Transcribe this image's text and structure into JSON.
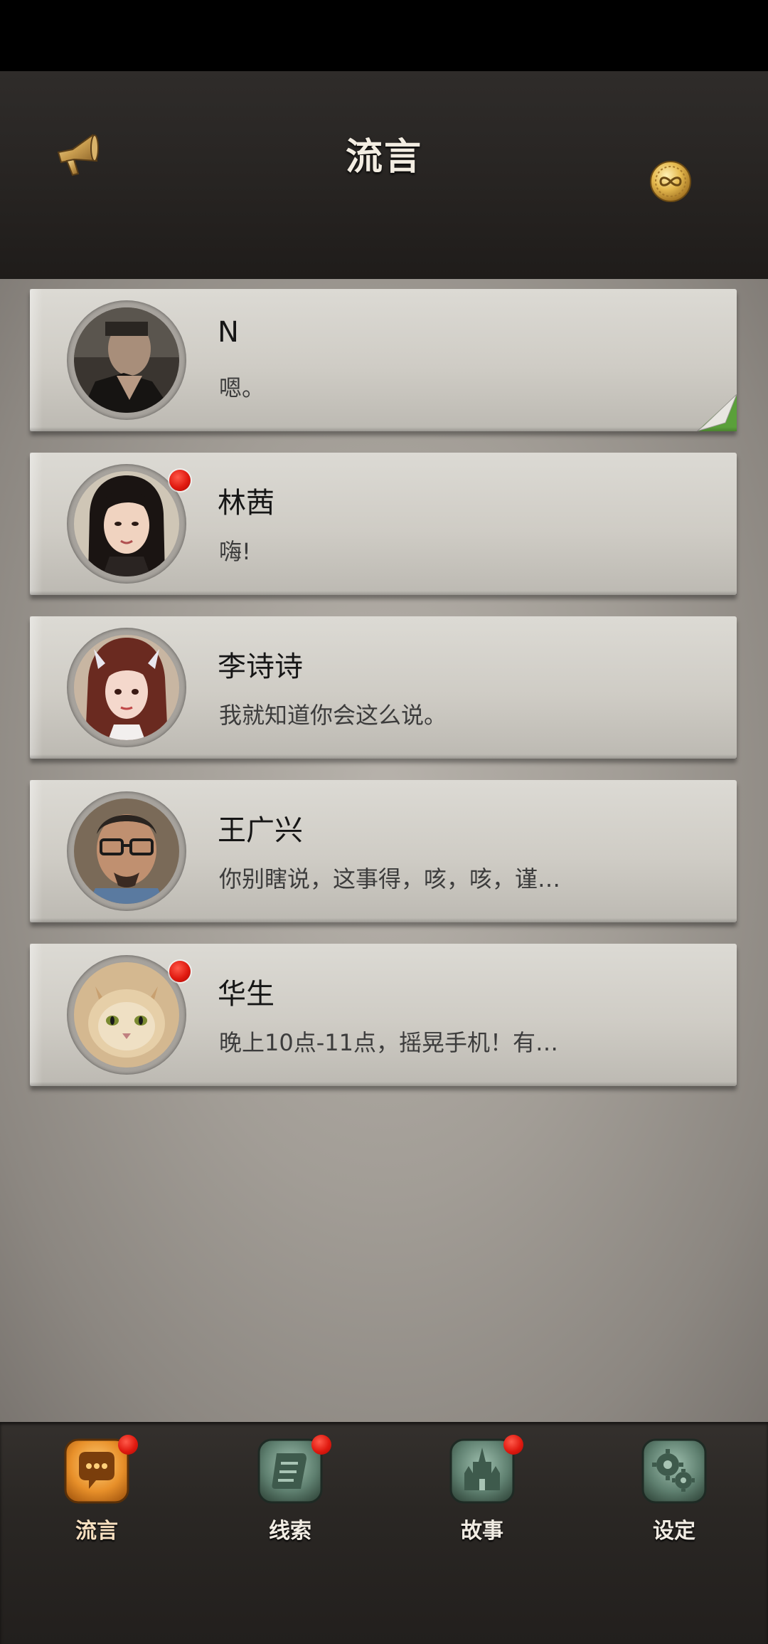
{
  "header": {
    "title": "流言",
    "left_icon": "megaphone-icon",
    "right_icon": "gold-coin-icon"
  },
  "messages": [
    {
      "name": "N",
      "preview": "嗯。",
      "unread": false,
      "avatar": "man-portrait"
    },
    {
      "name": "林茜",
      "preview": "嗨!",
      "unread": true,
      "avatar": "woman-portrait"
    },
    {
      "name": "李诗诗",
      "preview": "我就知道你会这么说。",
      "unread": false,
      "avatar": "girl-portrait"
    },
    {
      "name": "王广兴",
      "preview": "你别瞎说，这事得，咳，咳，谨…",
      "unread": false,
      "avatar": "glasses-man-portrait"
    },
    {
      "name": "华生",
      "preview": "晚上10点-11点，摇晃手机！有…",
      "unread": true,
      "avatar": "cat-portrait"
    }
  ],
  "tabs": [
    {
      "label": "流言",
      "icon": "chat-bubble-icon",
      "active": true,
      "badge": true
    },
    {
      "label": "线索",
      "icon": "scroll-icon",
      "active": false,
      "badge": true
    },
    {
      "label": "故事",
      "icon": "castle-icon",
      "active": false,
      "badge": true
    },
    {
      "label": "设定",
      "icon": "gears-icon",
      "active": false,
      "badge": false
    }
  ],
  "colors": {
    "header_bg": "#282523",
    "card_bg": "#d6d3cd",
    "badge_red": "#e01a10",
    "active_tab": "#e89a2c",
    "inactive_tab": "#5c7b6a"
  }
}
